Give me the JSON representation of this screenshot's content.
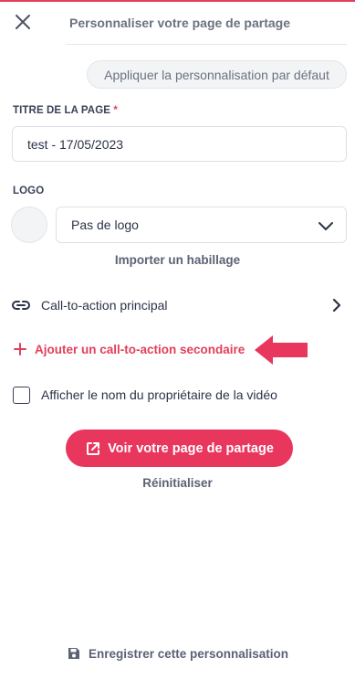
{
  "header": {
    "title": "Personnaliser votre page de partage"
  },
  "default_button": {
    "label": "Appliquer la personnalisation par défaut"
  },
  "page_title_field": {
    "label": "TITRE DE LA PAGE",
    "required_marker": "*",
    "value": "test - 17/05/2023"
  },
  "logo": {
    "label": "LOGO",
    "selected": "Pas de logo"
  },
  "import_skin": {
    "label": "Importer un habillage"
  },
  "primary_cta": {
    "label": "Call-to-action principal"
  },
  "secondary_cta": {
    "label": "Ajouter un call-to-action secondaire"
  },
  "show_owner": {
    "label": "Afficher le nom du propriétaire de la vidéo",
    "checked": false
  },
  "view_page_button": {
    "label": "Voir votre page de partage"
  },
  "reset": {
    "label": "Réinitialiser"
  },
  "save": {
    "label": "Enregistrer cette personnalisation"
  },
  "colors": {
    "accent": "#e8365d",
    "text": "#2c3348",
    "muted": "#6b7280"
  },
  "icons": [
    "close-icon",
    "chevron-down-icon",
    "link-icon",
    "chevron-right-icon",
    "plus-icon",
    "red-arrow-icon",
    "external-link-icon",
    "save-icon"
  ]
}
